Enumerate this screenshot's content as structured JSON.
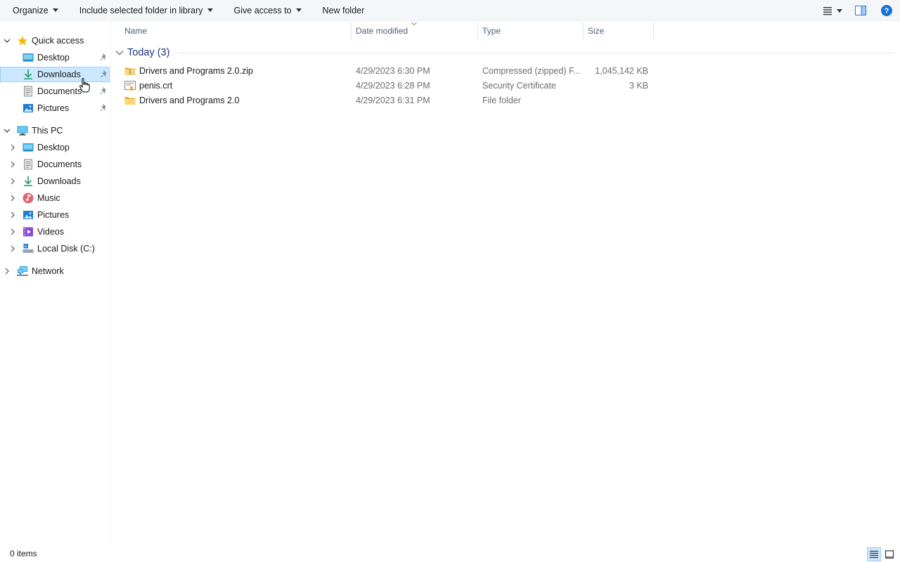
{
  "toolbar": {
    "organize": "Organize",
    "include_library": "Include selected folder in library",
    "give_access": "Give access to",
    "new_folder": "New folder",
    "view_icon": "details-view-icon",
    "preview_icon": "preview-pane-icon",
    "help_icon": "help-icon"
  },
  "nav": {
    "quick_access": "Quick access",
    "quick_items": [
      {
        "label": "Desktop",
        "icon": "desktop-icon"
      },
      {
        "label": "Downloads",
        "icon": "downloads-icon"
      },
      {
        "label": "Documents",
        "icon": "documents-icon"
      },
      {
        "label": "Pictures",
        "icon": "pictures-icon"
      }
    ],
    "this_pc": "This PC",
    "pc_items": [
      {
        "label": "Desktop",
        "icon": "desktop-icon"
      },
      {
        "label": "Documents",
        "icon": "documents-icon"
      },
      {
        "label": "Downloads",
        "icon": "downloads-icon"
      },
      {
        "label": "Music",
        "icon": "music-icon"
      },
      {
        "label": "Pictures",
        "icon": "pictures-icon"
      },
      {
        "label": "Videos",
        "icon": "videos-icon"
      },
      {
        "label": "Local Disk (C:)",
        "icon": "drive-icon"
      }
    ],
    "network": "Network",
    "selected": "Downloads"
  },
  "columns": {
    "name": "Name",
    "date_modified": "Date modified",
    "type": "Type",
    "size": "Size"
  },
  "group": {
    "label": "Today (3)"
  },
  "files": [
    {
      "name": "Drivers and Programs 2.0.zip",
      "date": "4/29/2023 6:30 PM",
      "type": "Compressed (zipped) F...",
      "size": "1,045,142 KB",
      "icon": "zip-folder-icon"
    },
    {
      "name": "penis.crt",
      "date": "4/29/2023 6:28 PM",
      "type": "Security Certificate",
      "size": "3 KB",
      "icon": "certificate-icon"
    },
    {
      "name": "Drivers and Programs 2.0",
      "date": "4/29/2023 6:31 PM",
      "type": "File folder",
      "size": "",
      "icon": "folder-icon"
    }
  ],
  "status": {
    "item_count": "0 items"
  },
  "colors": {
    "selection_bg": "#cce8ff",
    "selection_border": "#99d1ff",
    "group_header": "#1e3287",
    "column_header": "#4c607a"
  }
}
